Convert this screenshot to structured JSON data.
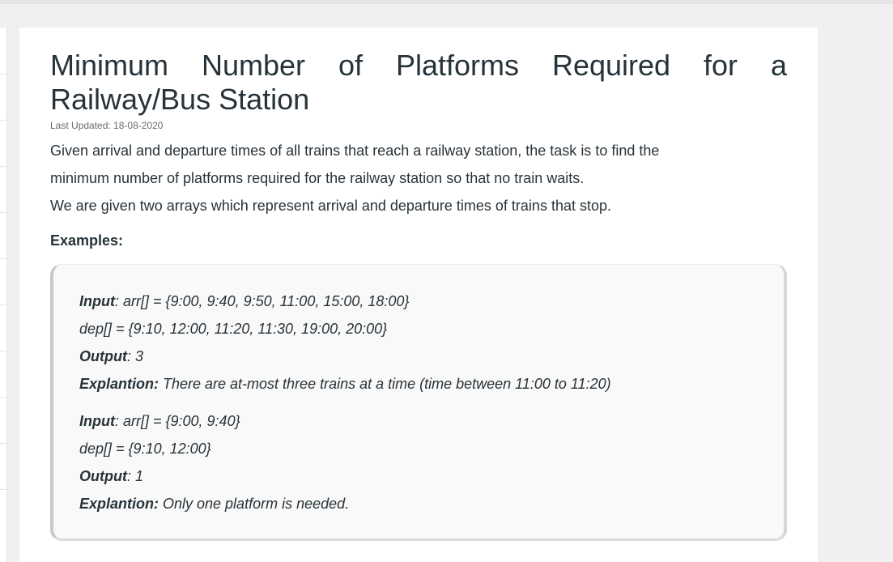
{
  "article": {
    "title": "Minimum Number of Platforms Required for a Railway/Bus Station",
    "last_updated": "Last Updated: 18-08-2020",
    "paragraphs": [
      "Given arrival and departure times of all trains that reach a railway station, the task is to find the",
      "minimum number of platforms required for the railway station so that no train waits.",
      "We are given two arrays which represent arrival and departure times of trains that stop."
    ],
    "examples_heading": "Examples:"
  },
  "examples": [
    {
      "input_label": "Input",
      "input_text": ": arr[] = {9:00, 9:40, 9:50, 11:00, 15:00, 18:00}",
      "dep_text": "dep[] = {9:10, 12:00, 11:20, 11:30, 19:00, 20:00}",
      "output_label": "Output",
      "output_text": ": 3",
      "explanation_label": "Explantion:",
      "explanation_text": " There are at-most three trains at a time (time between 11:00 to 11:20)"
    },
    {
      "input_label": "Input",
      "input_text": ": arr[] = {9:00, 9:40}",
      "dep_text": "dep[] = {9:10, 12:00}",
      "output_label": "Output",
      "output_text": ": 1",
      "explanation_label": "Explantion:",
      "explanation_text": " Only one platform is needed."
    }
  ]
}
